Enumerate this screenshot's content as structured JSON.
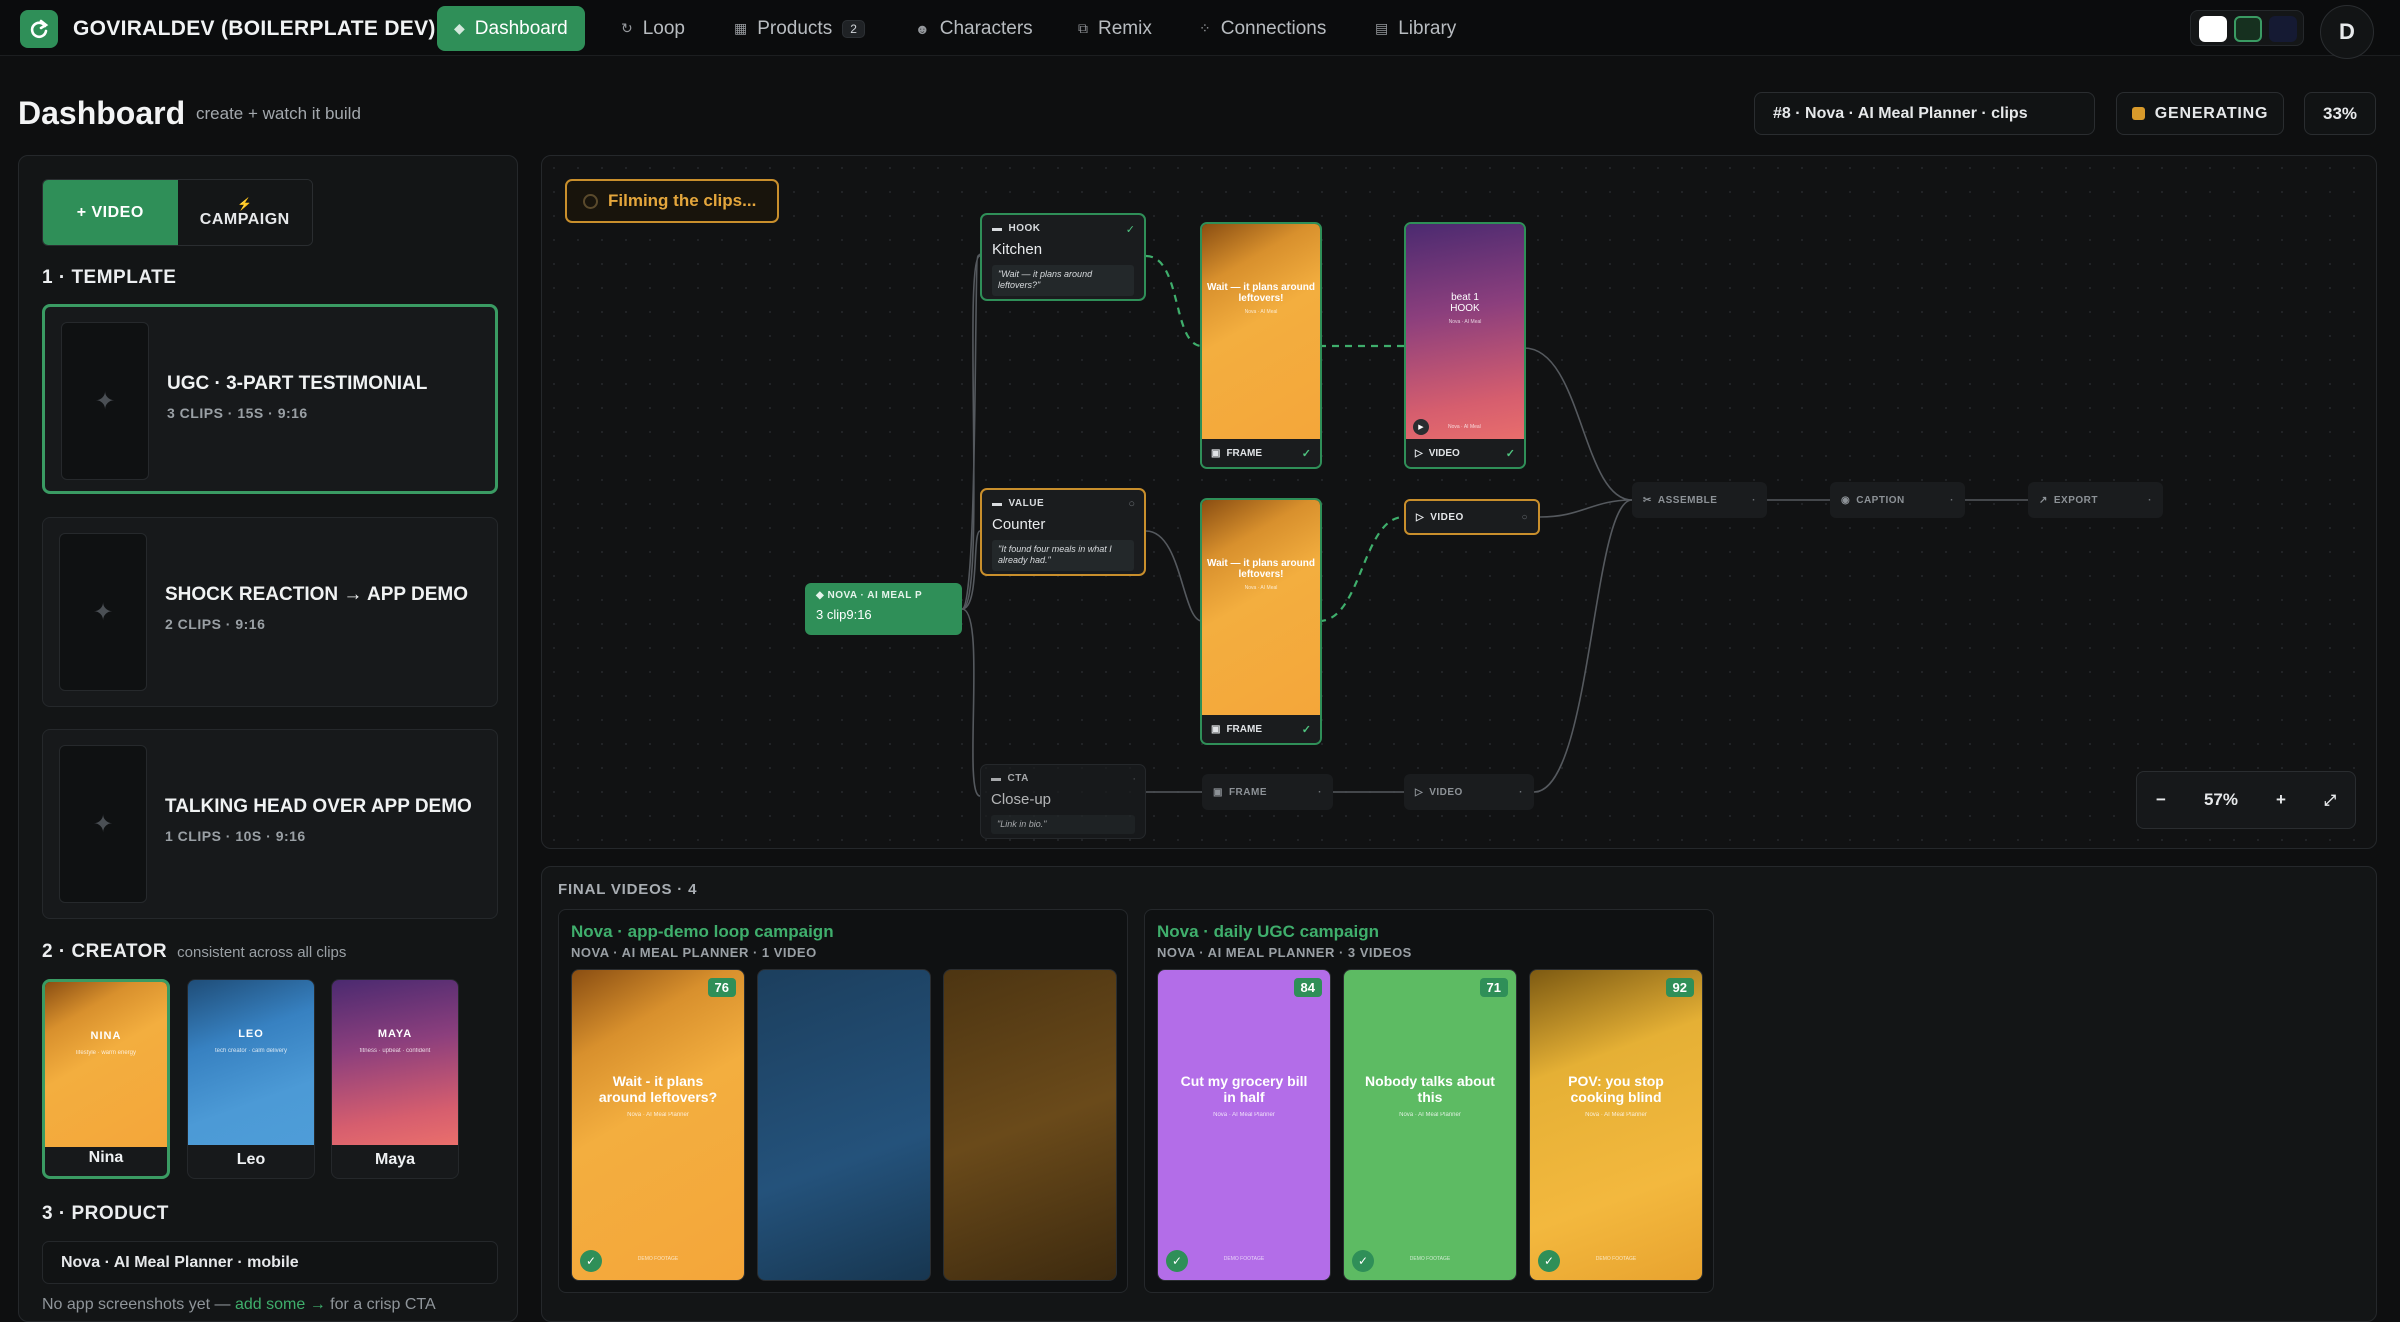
{
  "app": {
    "name": "GOVIRALDEV (BOILERPLATE DEV)",
    "avatar_initial": "D"
  },
  "nav": [
    {
      "label": "Dashboard",
      "icon": "diamond-icon",
      "active": true
    },
    {
      "label": "Loop",
      "icon": "loop-icon"
    },
    {
      "label": "Products",
      "icon": "box-icon",
      "badge": "2"
    },
    {
      "label": "Characters",
      "icon": "character-icon"
    },
    {
      "label": "Remix",
      "icon": "remix-icon"
    },
    {
      "label": "Connections",
      "icon": "connections-icon"
    },
    {
      "label": "Library",
      "icon": "library-icon"
    }
  ],
  "theme_swatches": [
    "#ffffff",
    "#16301f",
    "#151a33"
  ],
  "header": {
    "title": "Dashboard",
    "subtitle": "create + watch it build",
    "job": "#8 · Nova · AI Meal Planner · clips",
    "status": "GENERATING",
    "progress": "33%"
  },
  "left": {
    "toggle": {
      "video": "+ VIDEO",
      "campaign_icon": "⚡",
      "campaign": "CAMPAIGN"
    },
    "template_section": "1 · TEMPLATE",
    "templates": [
      {
        "title": "UGC · 3-PART TESTIMONIAL",
        "meta": "3 CLIPS · 15S · 9:16",
        "selected": true
      },
      {
        "title": "SHOCK REACTION → APP DEMO",
        "meta": "2 CLIPS · 9:16"
      },
      {
        "title": "TALKING HEAD OVER APP DEMO",
        "meta": "1 CLIPS · 10S · 9:16"
      }
    ],
    "creator_section": "2 · CREATOR",
    "creator_note": "consistent across all clips",
    "creators": [
      {
        "name": "Nina",
        "tag": "NINA",
        "sub": "lifestyle · warm energy",
        "selected": true
      },
      {
        "name": "Leo",
        "tag": "LEO",
        "sub": "tech creator · calm delivery"
      },
      {
        "name": "Maya",
        "tag": "MAYA",
        "sub": "fitness · upbeat · confident"
      }
    ],
    "product_section": "3 · PRODUCT",
    "product": "Nova · AI Meal Planner · mobile",
    "product_note_pre": "No app screenshots yet —",
    "product_note_link": "add some →",
    "product_note_post": "for a crisp CTA"
  },
  "canvas": {
    "status": "Filming the clips...",
    "root": {
      "label": "NOVA · AI MEAL P",
      "sub": "3 clip9:16"
    },
    "shots": [
      {
        "tag": "HOOK",
        "name": "Kitchen",
        "quote": "\"Wait — it plans around leftovers?\""
      },
      {
        "tag": "VALUE",
        "name": "Counter",
        "quote": "\"It found four meals in what I already had.\""
      },
      {
        "tag": "CTA",
        "name": "Close-up",
        "quote": "\"Link in bio.\""
      }
    ],
    "frame_text": "Wait — it plans around leftovers!",
    "frame_sub": "Nova · AI Meal",
    "video_text": "beat 1\nHOOK",
    "video_sub": "Nova · AI Meal",
    "video_foot": "Nova · AI Meal",
    "labels": {
      "frame": "FRAME",
      "video": "VIDEO",
      "assemble": "ASSEMBLE",
      "caption": "CAPTION",
      "export": "EXPORT"
    },
    "zoom": "57%",
    "zoom_out": "−",
    "zoom_in": "+",
    "fit": "⤢"
  },
  "finals": {
    "title": "FINAL VIDEOS · 4",
    "campaigns": [
      {
        "title": "Nova · app-demo loop campaign",
        "meta": "NOVA · AI MEAL PLANNER · 1 VIDEO",
        "videos": [
          {
            "text": "Wait - it plans around leftovers?",
            "sub": "Nova · AI Meal Planner",
            "score": "76",
            "done": true
          },
          {
            "text": "",
            "sub": "",
            "score": ""
          },
          {
            "text": "",
            "sub": "",
            "score": ""
          }
        ]
      },
      {
        "title": "Nova · daily UGC campaign",
        "meta": "NOVA · AI MEAL PLANNER · 3 VIDEOS",
        "videos": [
          {
            "text": "Cut my grocery bill in half",
            "sub": "Nova · AI Meal Planner",
            "score": "84",
            "done": true
          },
          {
            "text": "Nobody talks about this",
            "sub": "Nova · AI Meal Planner",
            "score": "71",
            "done": true
          },
          {
            "text": "POV: you stop cooking blind",
            "sub": "Nova · AI Meal Planner",
            "score": "92",
            "done": true
          }
        ]
      }
    ],
    "video_footer": "DEMO FOOTAGE"
  }
}
